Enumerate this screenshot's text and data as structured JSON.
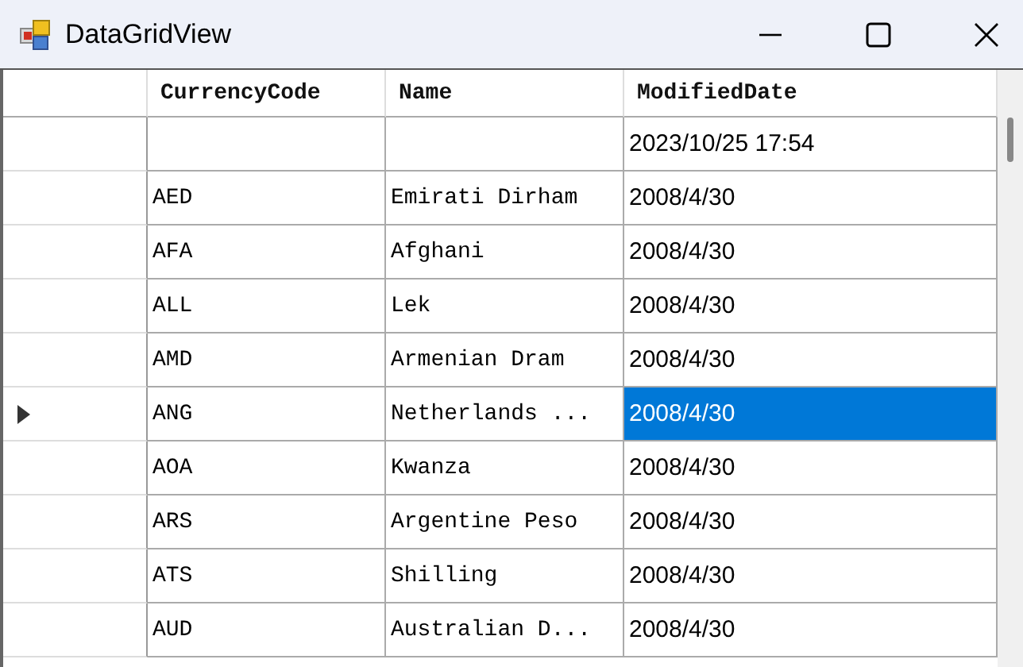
{
  "window": {
    "title": "DataGridView"
  },
  "table": {
    "columns": [
      "CurrencyCode",
      "Name",
      "ModifiedDate"
    ],
    "rows": [
      {
        "current": false,
        "cells": [
          {
            "selected": false
          },
          {
            "selected": false
          },
          {
            "text": "2023/10/25 17:54",
            "selected": false
          }
        ]
      },
      {
        "current": false,
        "cells": [
          {
            "text": "AED",
            "selected": false
          },
          {
            "text": "Emirati Dirham",
            "selected": false
          },
          {
            "text": "2008/4/30",
            "selected": false
          }
        ]
      },
      {
        "current": false,
        "cells": [
          {
            "text": "AFA",
            "selected": false
          },
          {
            "text": "Afghani",
            "selected": false
          },
          {
            "text": "2008/4/30",
            "selected": false
          }
        ]
      },
      {
        "current": false,
        "cells": [
          {
            "text": "ALL",
            "selected": false
          },
          {
            "text": "Lek",
            "selected": false
          },
          {
            "text": "2008/4/30",
            "selected": false
          }
        ]
      },
      {
        "current": false,
        "cells": [
          {
            "text": "AMD",
            "selected": false
          },
          {
            "text": "Armenian Dram",
            "selected": false
          },
          {
            "text": "2008/4/30",
            "selected": false
          }
        ]
      },
      {
        "current": true,
        "cells": [
          {
            "text": "ANG",
            "selected": false
          },
          {
            "text": "Netherlands ...",
            "selected": false
          },
          {
            "text": "2008/4/30",
            "selected": true
          }
        ]
      },
      {
        "current": false,
        "cells": [
          {
            "text": "AOA",
            "selected": false
          },
          {
            "text": "Kwanza",
            "selected": false
          },
          {
            "text": "2008/4/30",
            "selected": false
          }
        ]
      },
      {
        "current": false,
        "cells": [
          {
            "text": "ARS",
            "selected": false
          },
          {
            "text": "Argentine Peso",
            "selected": false
          },
          {
            "text": "2008/4/30",
            "selected": false
          }
        ]
      },
      {
        "current": false,
        "cells": [
          {
            "text": "ATS",
            "selected": false
          },
          {
            "text": "Shilling",
            "selected": false
          },
          {
            "text": "2008/4/30",
            "selected": false
          }
        ]
      },
      {
        "current": false,
        "cells": [
          {
            "text": "AUD",
            "selected": false
          },
          {
            "text": "Australian D...",
            "selected": false
          },
          {
            "text": "2008/4/30",
            "selected": false
          }
        ]
      }
    ]
  }
}
